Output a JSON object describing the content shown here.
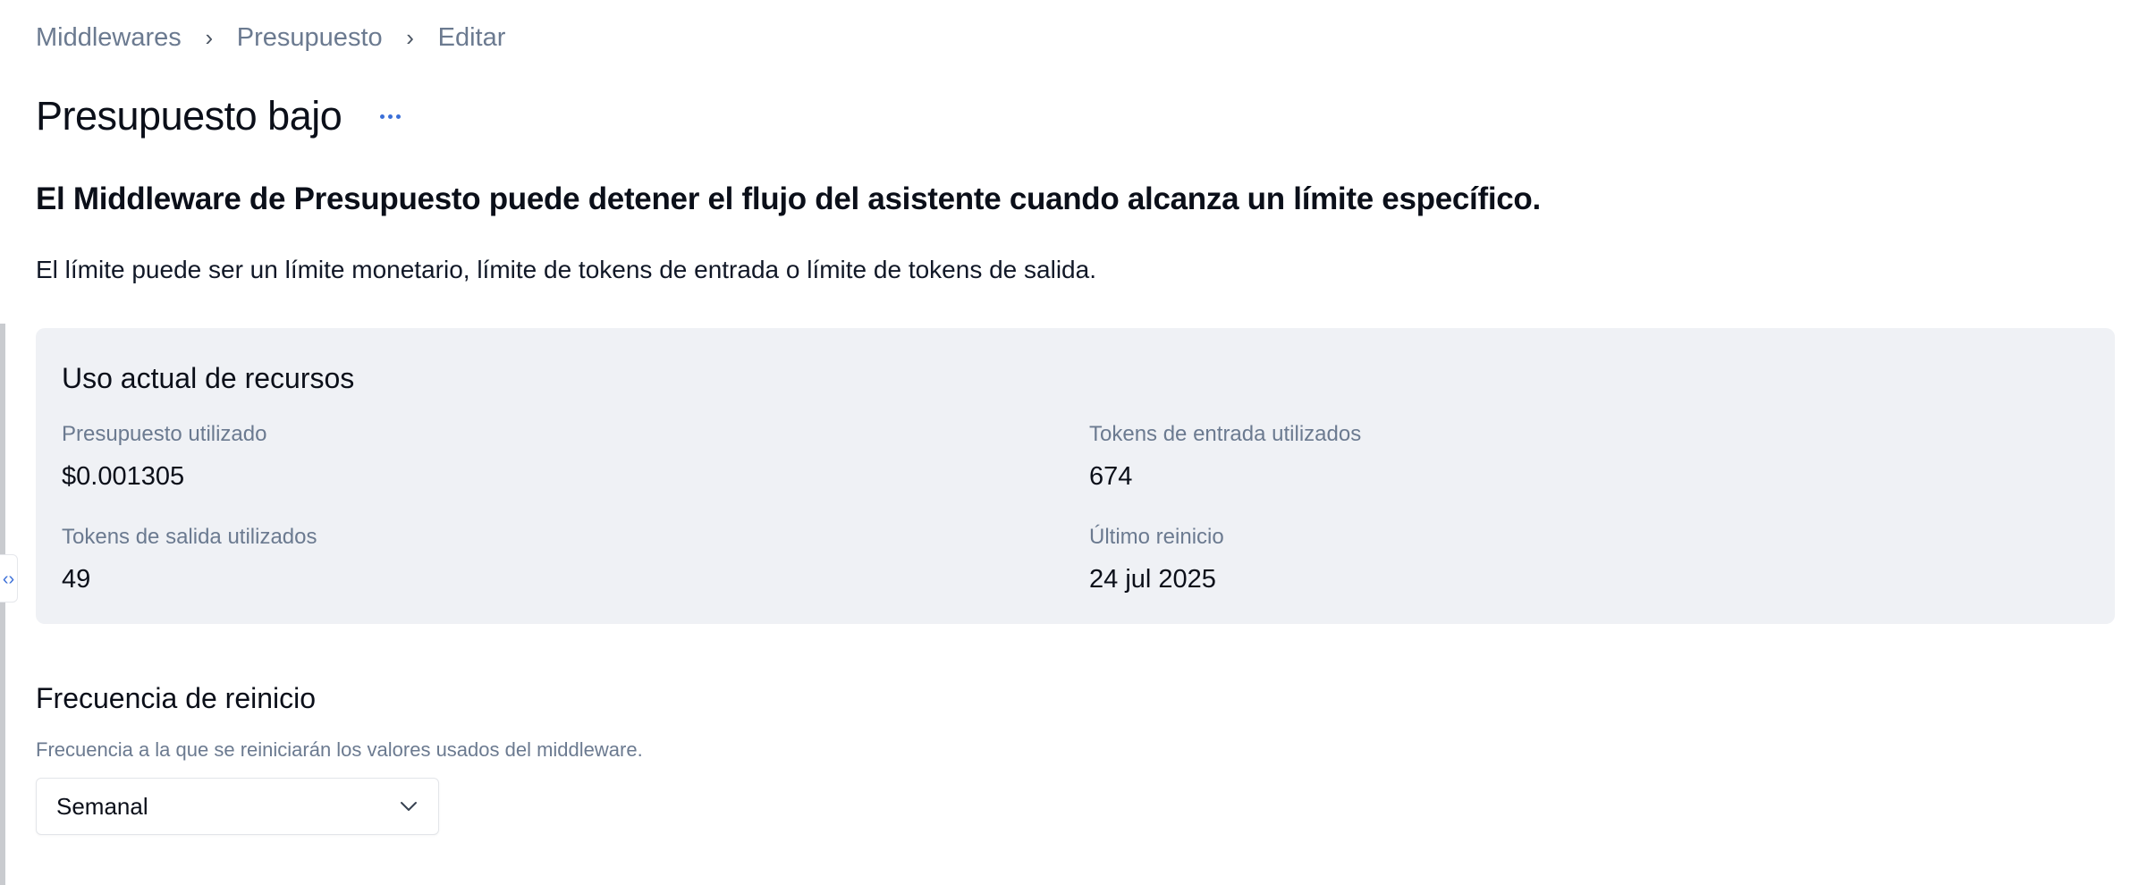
{
  "breadcrumb": {
    "items": [
      "Middlewares",
      "Presupuesto",
      "Editar"
    ],
    "separator_icon": "chevron-right-icon"
  },
  "page": {
    "title": "Presupuesto bajo",
    "more_icon": "more-horizontal-icon",
    "headline": "El Middleware de Presupuesto puede detener el flujo del asistente cuando alcanza un límite específico.",
    "description": "El límite puede ser un límite monetario, límite de tokens de entrada o límite de tokens de salida."
  },
  "usage": {
    "title": "Uso actual de recursos",
    "metrics": [
      {
        "label": "Presupuesto utilizado",
        "value": "$0.001305"
      },
      {
        "label": "Tokens de entrada utilizados",
        "value": "674"
      },
      {
        "label": "Tokens de salida utilizados",
        "value": "49"
      },
      {
        "label": "Último reinicio",
        "value": "24 jul 2025"
      }
    ]
  },
  "reset_frequency": {
    "title": "Frecuencia de reinicio",
    "help": "Frecuencia a la que se reiniciarán los valores usados del middleware.",
    "selected": "Semanal",
    "chevron_icon": "chevron-down-icon"
  },
  "panel_toggle": {
    "icon": "code-brackets-icon",
    "glyph": "‹›"
  },
  "colors": {
    "accent": "#3b6fd8",
    "muted_text": "#6b7a90",
    "card_background": "#eff1f5"
  }
}
